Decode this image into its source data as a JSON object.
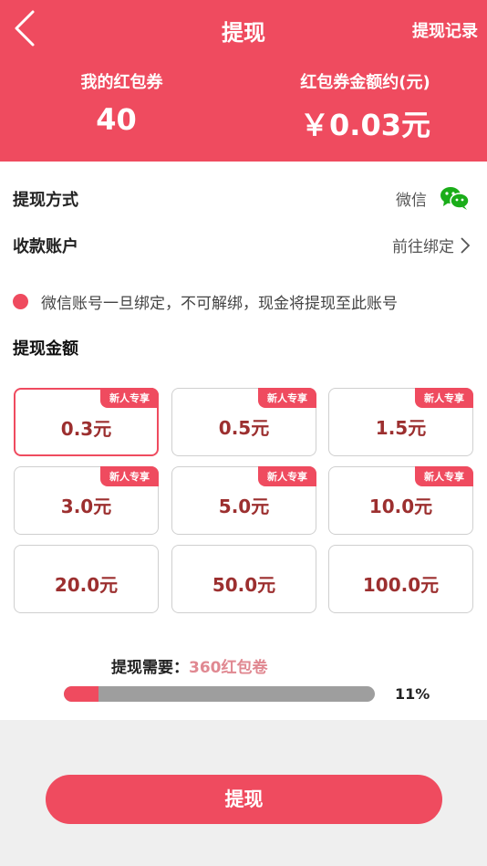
{
  "header": {
    "title": "提现",
    "record_link": "提现记录",
    "coupon_label": "我的红包券",
    "coupon_count": "40",
    "amount_label": "红包券金额约(元)",
    "amount_value": "￥0.03元"
  },
  "method": {
    "label": "提现方式",
    "value": "微信",
    "icon": "wechat-icon"
  },
  "account": {
    "label": "收款账户",
    "value": "前往绑定"
  },
  "notice": "微信账号一旦绑定，不可解绑，现金将提现至此账号",
  "amount_section": {
    "title": "提现金额",
    "options": [
      {
        "value": "0.3元",
        "tag": "新人专享"
      },
      {
        "value": "0.5元",
        "tag": "新人专享"
      },
      {
        "value": "1.5元",
        "tag": "新人专享"
      },
      {
        "value": "3.0元",
        "tag": "新人专享"
      },
      {
        "value": "5.0元",
        "tag": "新人专享"
      },
      {
        "value": "10.0元",
        "tag": "新人专享"
      },
      {
        "value": "20.0元"
      },
      {
        "value": "50.0元"
      },
      {
        "value": "100.0元"
      }
    ]
  },
  "requirement": {
    "label": "提现需要：",
    "value": "360红包卷",
    "progress_percent": 11,
    "progress_text": "11%"
  },
  "submit_label": "提现",
  "colors": {
    "accent": "#ef4b5f",
    "wechat": "#1aad19",
    "amount_text": "#9c2f2f"
  }
}
